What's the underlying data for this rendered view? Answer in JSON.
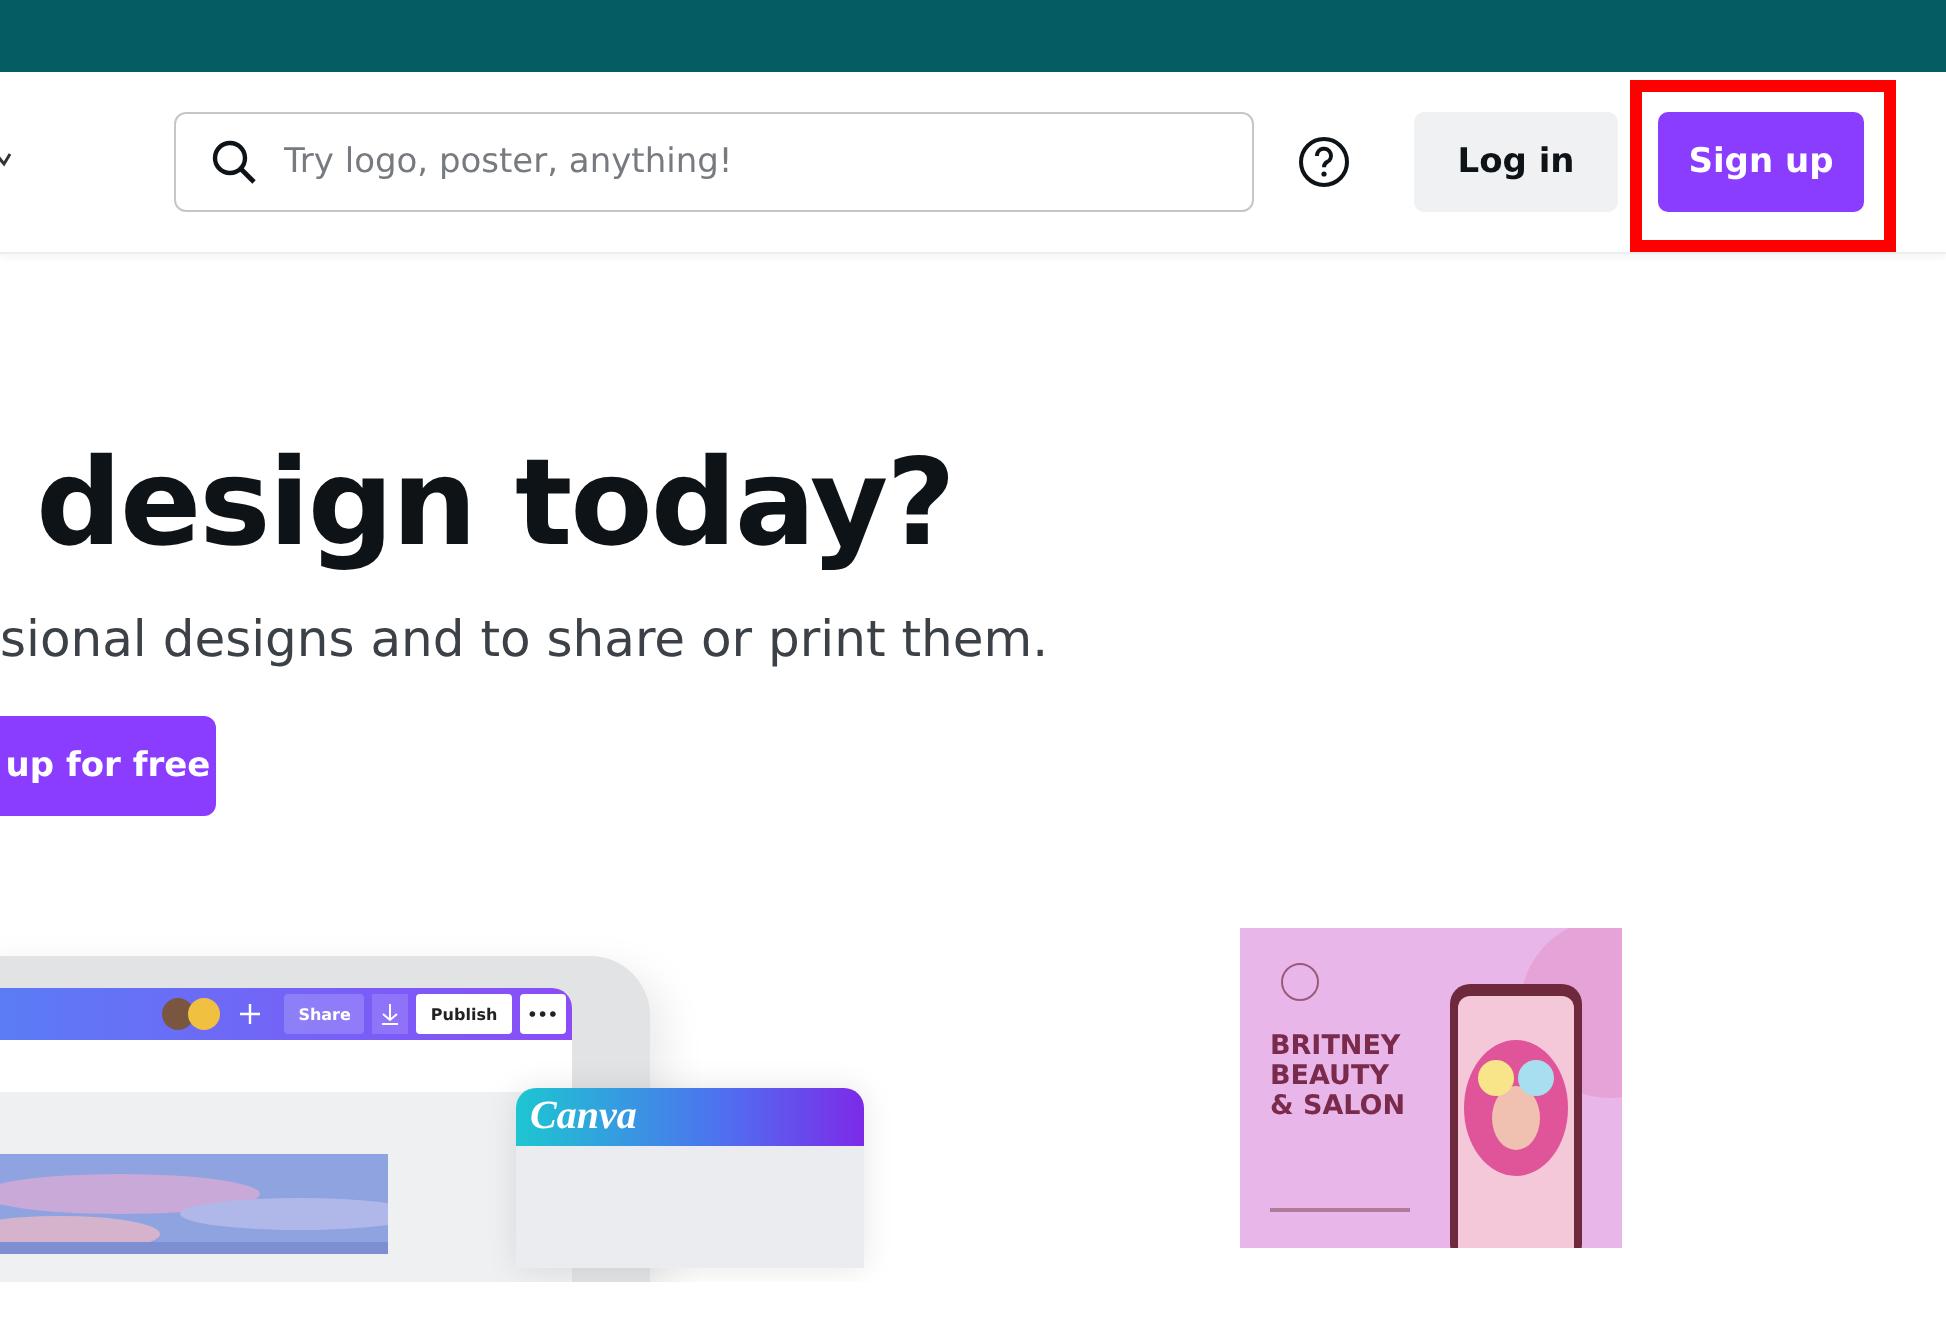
{
  "header": {
    "search": {
      "placeholder": "Try logo, poster, anything!"
    },
    "login": "Log in",
    "signup": "Sign up",
    "signup_highlighted": true
  },
  "hero": {
    "title": "design today?",
    "subtitle": "sional designs and to share or print them.",
    "cta": "up for free"
  },
  "editor": {
    "buttons": [
      "Share",
      "Publish",
      "•••"
    ],
    "card_title": "Canva"
  },
  "poster": {
    "title_lines": [
      "BRITNEY",
      "BEAUTY",
      "& SALON"
    ]
  }
}
